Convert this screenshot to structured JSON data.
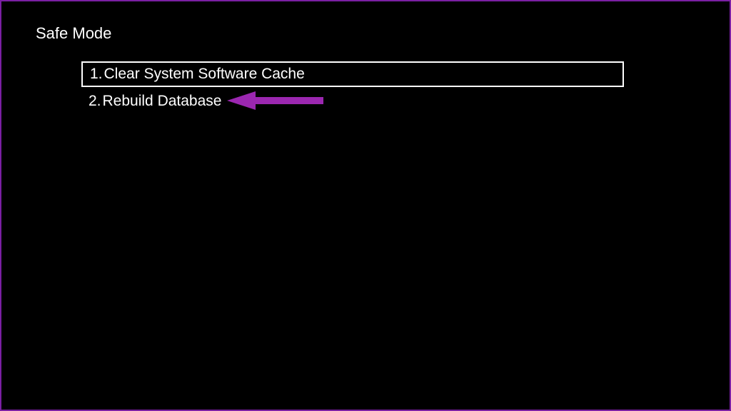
{
  "header": {
    "title": "Safe Mode"
  },
  "menu": {
    "items": [
      {
        "number": "1.",
        "label": "Clear System Software Cache",
        "selected": true
      },
      {
        "number": "2.",
        "label": "Rebuild Database",
        "selected": false
      }
    ]
  },
  "annotation": {
    "arrow_color": "#9b27b0",
    "points_to": "rebuild-database"
  },
  "frame": {
    "border_color": "#7a1fa2"
  }
}
